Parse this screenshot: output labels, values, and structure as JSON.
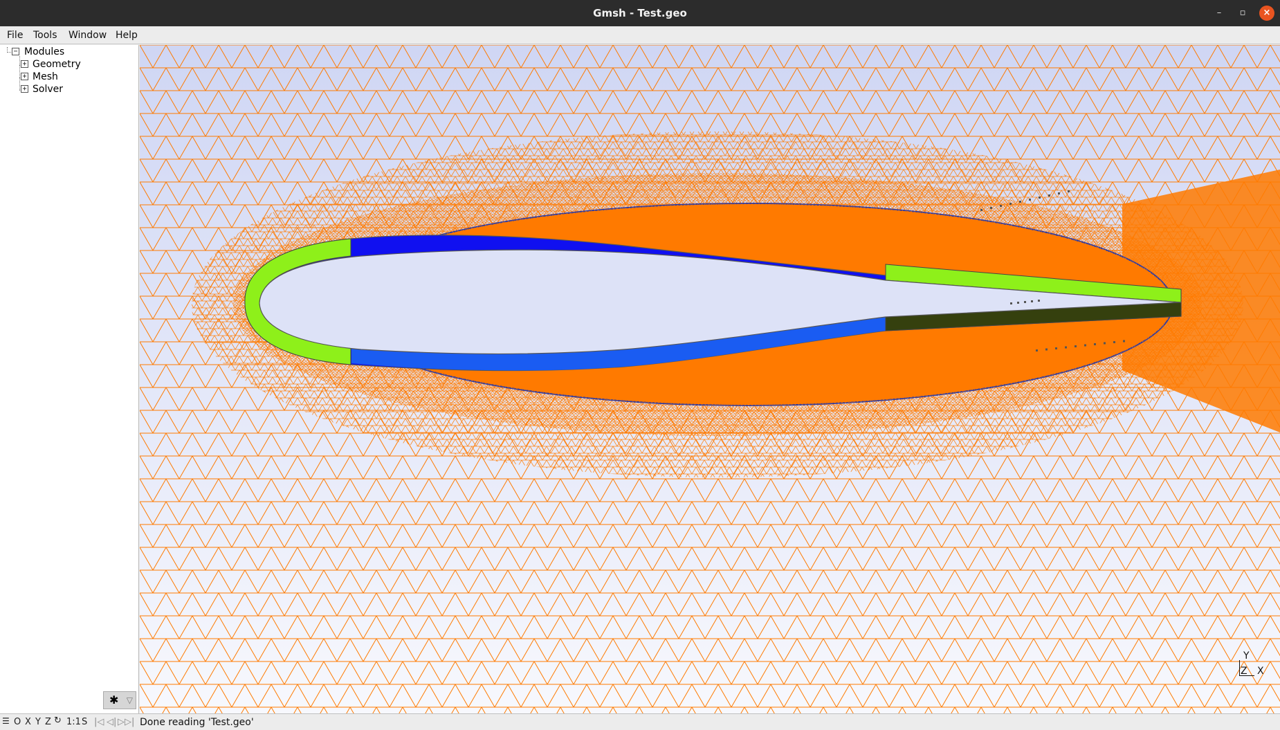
{
  "window": {
    "title": "Gmsh - Test.geo",
    "controls": {
      "minimize": "–",
      "maximize": "▫",
      "close": "×"
    }
  },
  "menu": [
    "File",
    "Tools",
    "Window",
    "Help"
  ],
  "tree": {
    "root": {
      "label": "Modules",
      "expander": "−"
    },
    "children": [
      {
        "label": "Geometry",
        "expander": "+"
      },
      {
        "label": "Mesh",
        "expander": "+"
      },
      {
        "label": "Solver",
        "expander": "+"
      }
    ]
  },
  "bottom_left_button": {
    "icon": "gear-icon",
    "glyph": "✱",
    "dropdown": "▽"
  },
  "viewport": {
    "axes": {
      "y": "Y",
      "z": "Z",
      "x": "X"
    },
    "colors": {
      "background_top": "#cfd6f4",
      "background_bottom": "#f7f8fd",
      "mesh": "#ff7a00",
      "boundary": "#2a3aa6",
      "region_blue": "#1010f0",
      "region_blue_lower": "#1a5cf2",
      "region_green": "#8ef01a",
      "region_dark": "#35400e"
    }
  },
  "statusbar": {
    "buttons": [
      "O",
      "X",
      "Y",
      "Z",
      "1:1",
      "S"
    ],
    "message": "Done reading 'Test.geo'"
  }
}
